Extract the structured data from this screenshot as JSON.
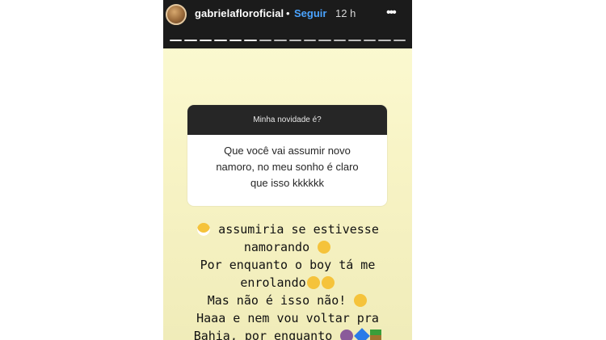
{
  "header": {
    "username": "gabrielafloroficial",
    "separator": "•",
    "follow_label": "Seguir",
    "time": "12 h",
    "more_glyph": "•••"
  },
  "progress": {
    "segments_total": 16,
    "segments_done": 6
  },
  "question": {
    "prompt": "Minha novidade é?",
    "answer_lines": [
      "Que você vai assumir novo",
      "namoro, no meu sonho é claro",
      "que isso kkkkkk"
    ]
  },
  "reply": {
    "line1": "assumiria se estivesse",
    "line2": "namorando",
    "line3": "Por enquanto o boy tá me",
    "line4": "enrolando",
    "line5": "Mas não é isso não!",
    "line6": "Haaa e nem vou voltar pra",
    "line7": "Bahia, por enquanto"
  },
  "icons": {
    "avatar": "profile-avatar",
    "grimace": "grimace-emoji",
    "laugh": "laugh-emoji",
    "think": "thinking-emoji",
    "roll": "eye-roll-emoji",
    "wink": "wink-tongue-emoji",
    "woman": "woman-emoji",
    "heart": "blue-heart-emoji",
    "palm": "palm-tree-emoji"
  },
  "colors": {
    "topbar": "#1b1b1b",
    "follow": "#4aa3ff",
    "background_yellow": "#f8f4c6",
    "question_header": "#262626"
  }
}
